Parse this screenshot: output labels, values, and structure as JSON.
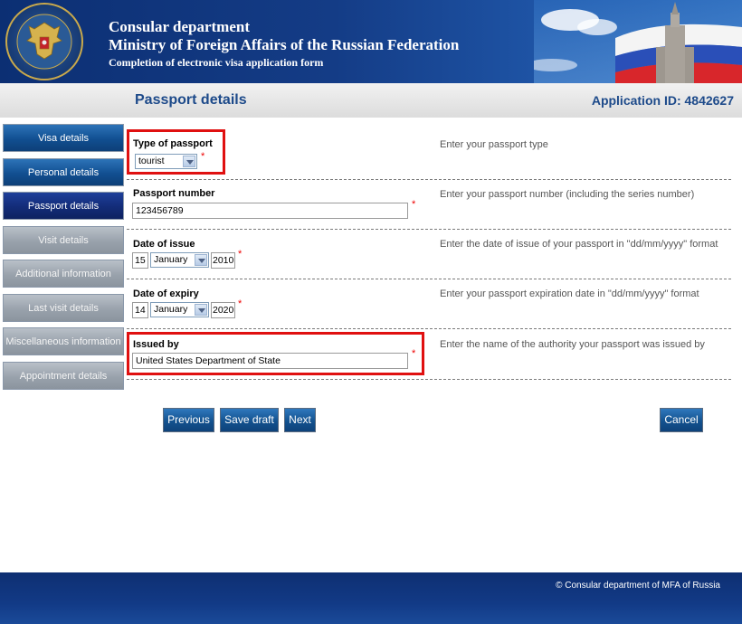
{
  "header": {
    "line1": "Consular department",
    "line2": "Ministry of Foreign Affairs of the Russian Federation",
    "line3": "Completion of electronic visa application form"
  },
  "subheader": {
    "page_title": "Passport details",
    "application_id": "Application ID: 4842627"
  },
  "sidebar": {
    "items": [
      {
        "label": "Visa details",
        "state": "blue"
      },
      {
        "label": "Personal details",
        "state": "blue"
      },
      {
        "label": "Passport details",
        "state": "active"
      },
      {
        "label": "Visit details",
        "state": "gray"
      },
      {
        "label": "Additional information",
        "state": "gray"
      },
      {
        "label": "Last visit details",
        "state": "gray"
      },
      {
        "label": "Miscellaneous information",
        "state": "gray"
      },
      {
        "label": "Appointment details",
        "state": "gray"
      }
    ]
  },
  "form": {
    "type_of_passport": {
      "label": "Type of passport",
      "value": "tourist",
      "hint": "Enter your passport type"
    },
    "passport_number": {
      "label": "Passport number",
      "value": "123456789",
      "hint": "Enter your passport number (including the series number)"
    },
    "date_of_issue": {
      "label": "Date of issue",
      "day": "15",
      "month": "January",
      "year": "2010",
      "hint": "Enter the date of issue of your passport in \"dd/mm/yyyy\" format"
    },
    "date_of_expiry": {
      "label": "Date of expiry",
      "day": "14",
      "month": "January",
      "year": "2020",
      "hint": "Enter your passport expiration date in \"dd/mm/yyyy\" format"
    },
    "issued_by": {
      "label": "Issued by",
      "value": "United States Department of State",
      "hint": "Enter the name of the authority your passport was issued by"
    },
    "required_mark": "*"
  },
  "buttons": {
    "previous": "Previous",
    "save_draft": "Save draft",
    "next": "Next",
    "cancel": "Cancel"
  },
  "footer": {
    "copyright": "© Consular department of MFA of Russia"
  },
  "colors": {
    "accent_blue": "#1d4a8a",
    "highlight_red": "#e01010",
    "required_red": "#e00000"
  }
}
